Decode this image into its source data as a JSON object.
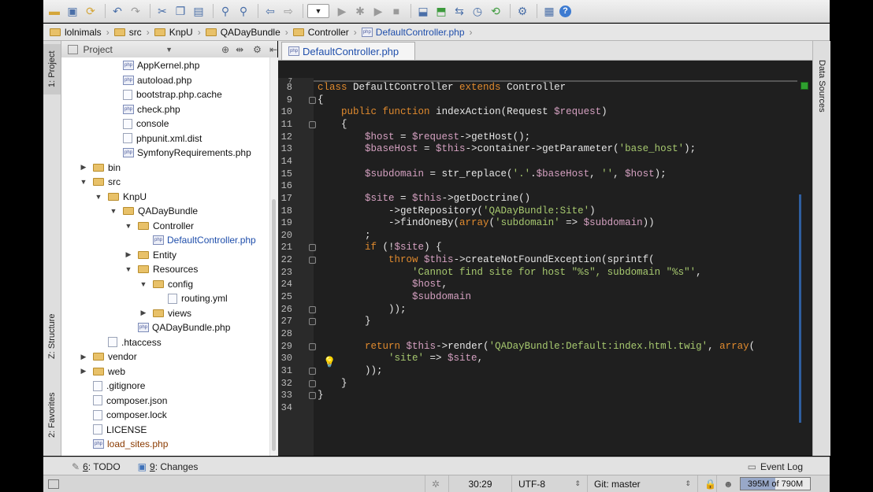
{
  "breadcrumb": [
    "lolnimals",
    "src",
    "KnpU",
    "QADayBundle",
    "Controller",
    "DefaultController.php"
  ],
  "left_strip": {
    "project": "1: Project",
    "structure": "Z: Structure",
    "favorites": "2: Favorites"
  },
  "right_strip": {
    "data_sources": "Data Sources"
  },
  "project_panel": {
    "title": "Project"
  },
  "tree": [
    {
      "label": "AppKernel.php",
      "type": "php",
      "depth": 3
    },
    {
      "label": "autoload.php",
      "type": "php",
      "depth": 3
    },
    {
      "label": "bootstrap.php.cache",
      "type": "file",
      "depth": 3
    },
    {
      "label": "check.php",
      "type": "php",
      "depth": 3
    },
    {
      "label": "console",
      "type": "file",
      "depth": 3
    },
    {
      "label": "phpunit.xml.dist",
      "type": "file",
      "depth": 3
    },
    {
      "label": "SymfonyRequirements.php",
      "type": "php",
      "depth": 3
    },
    {
      "label": "bin",
      "type": "folder",
      "depth": 1,
      "arrow": "right"
    },
    {
      "label": "src",
      "type": "folder",
      "depth": 1,
      "arrow": "down"
    },
    {
      "label": "KnpU",
      "type": "folder",
      "depth": 2,
      "arrow": "down"
    },
    {
      "label": "QADayBundle",
      "type": "folder",
      "depth": 3,
      "arrow": "down"
    },
    {
      "label": "Controller",
      "type": "folder",
      "depth": 4,
      "arrow": "down"
    },
    {
      "label": "DefaultController.php",
      "type": "php",
      "depth": 5,
      "selected": true
    },
    {
      "label": "Entity",
      "type": "folder",
      "depth": 4,
      "arrow": "right"
    },
    {
      "label": "Resources",
      "type": "folder",
      "depth": 4,
      "arrow": "down"
    },
    {
      "label": "config",
      "type": "folder",
      "depth": 5,
      "arrow": "down"
    },
    {
      "label": "routing.yml",
      "type": "file",
      "depth": 6
    },
    {
      "label": "views",
      "type": "folder",
      "depth": 5,
      "arrow": "right"
    },
    {
      "label": "QADayBundle.php",
      "type": "php",
      "depth": 4
    },
    {
      "label": ".htaccess",
      "type": "file",
      "depth": 2
    },
    {
      "label": "vendor",
      "type": "folder",
      "depth": 1,
      "arrow": "right"
    },
    {
      "label": "web",
      "type": "folder",
      "depth": 1,
      "arrow": "right"
    },
    {
      "label": ".gitignore",
      "type": "file",
      "depth": 1
    },
    {
      "label": "composer.json",
      "type": "file",
      "depth": 1
    },
    {
      "label": "composer.lock",
      "type": "file",
      "depth": 1
    },
    {
      "label": "LICENSE",
      "type": "file",
      "depth": 1
    },
    {
      "label": "load_sites.php",
      "type": "php",
      "depth": 1,
      "special": true
    }
  ],
  "editor": {
    "tab_label": "DefaultController.php",
    "first_line": 7,
    "lines": [
      "",
      "class DefaultController extends Controller",
      "{",
      "    public function indexAction(Request $request)",
      "    {",
      "        $host = $request->getHost();",
      "        $baseHost = $this->container->getParameter('base_host');",
      "",
      "        $subdomain = str_replace('.'.$baseHost, '', $host);",
      "",
      "        $site = $this->getDoctrine()",
      "            ->getRepository('QADayBundle:Site')",
      "            ->findOneBy(array('subdomain' => $subdomain))",
      "        ;",
      "        if (!$site) {",
      "            throw $this->createNotFoundException(sprintf(",
      "                'Cannot find site for host \"%s\", subdomain \"%s\"',",
      "                $host,",
      "                $subdomain",
      "            ));",
      "        }",
      "",
      "        return $this->render('QADayBundle:Default:index.html.twig', array(",
      "            'site' => $site,",
      "        ));",
      "    }",
      "}",
      ""
    ]
  },
  "bottom_tools": {
    "todo": "6: TODO",
    "todo_num": "6",
    "todo_rest": ": TODO",
    "changes_num": "9",
    "changes_rest": ": Changes",
    "event_log": "Event Log"
  },
  "status": {
    "position": "30:29",
    "encoding": "UTF-8",
    "vcs": "Git: master",
    "memory": "395M of 790M"
  }
}
